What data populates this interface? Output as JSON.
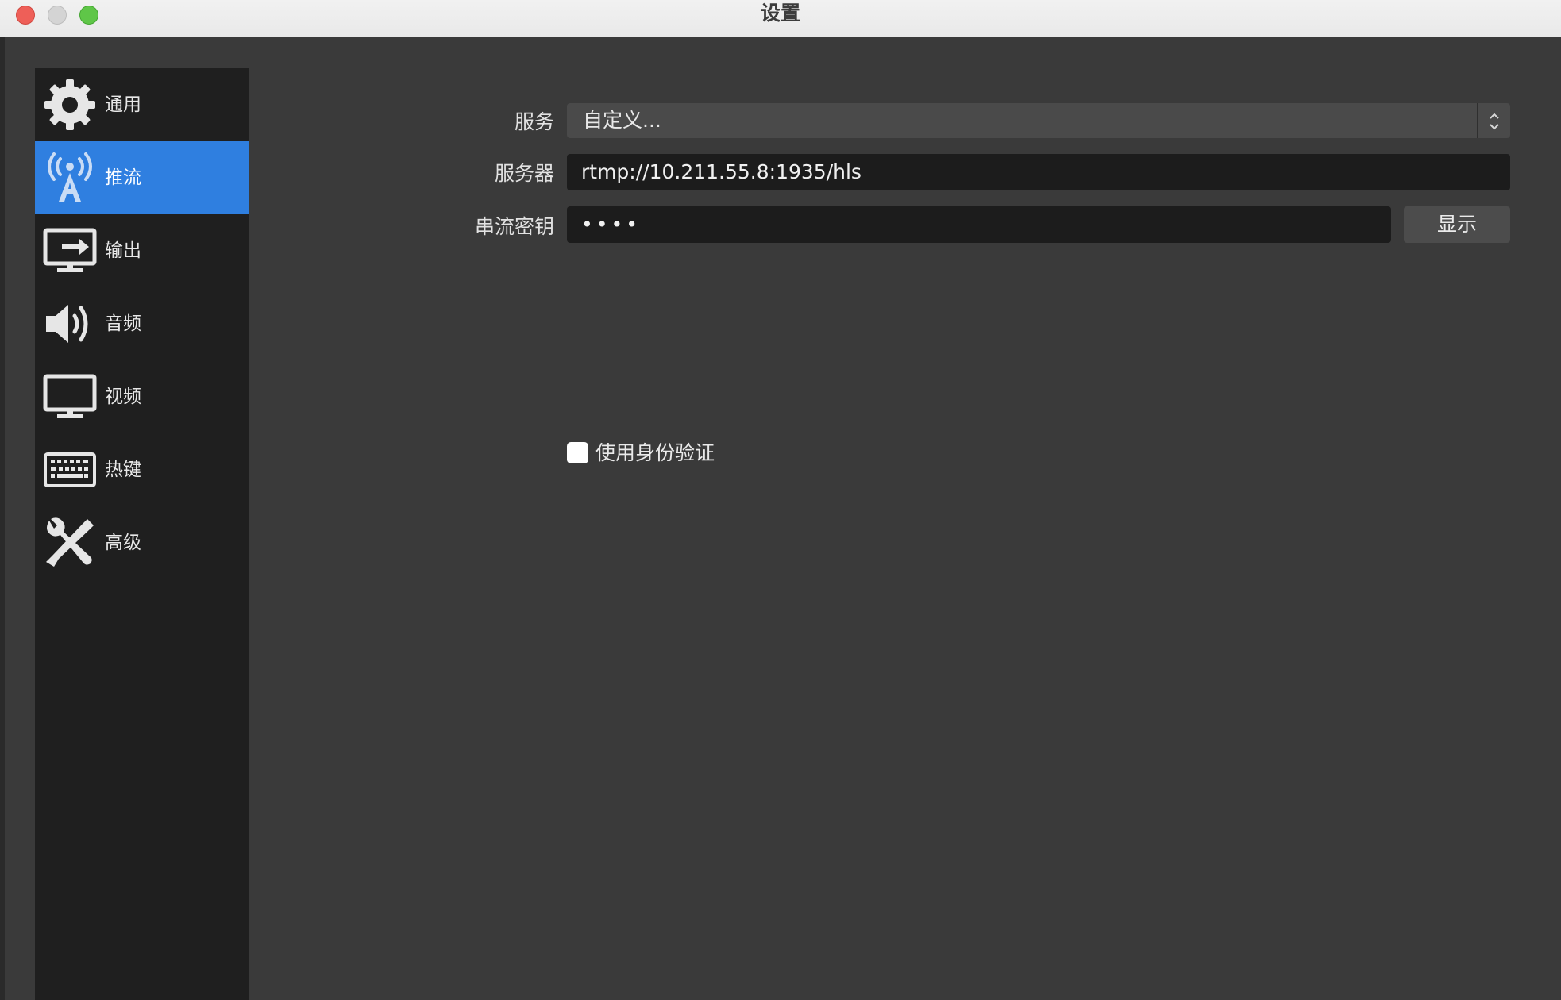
{
  "window": {
    "title": "设置"
  },
  "sidebar": {
    "items": [
      {
        "label": "通用",
        "icon": "gear-icon",
        "active": false
      },
      {
        "label": "推流",
        "icon": "broadcast-antenna-icon",
        "active": true
      },
      {
        "label": "输出",
        "icon": "output-monitor-icon",
        "active": false
      },
      {
        "label": "音频",
        "icon": "speaker-icon",
        "active": false
      },
      {
        "label": "视频",
        "icon": "monitor-icon",
        "active": false
      },
      {
        "label": "热键",
        "icon": "keyboard-icon",
        "active": false
      },
      {
        "label": "高级",
        "icon": "wrench-screwdriver-icon",
        "active": false
      }
    ]
  },
  "form": {
    "service_label": "服务",
    "service_value": "自定义...",
    "server_label": "服务器",
    "server_value": "rtmp://10.211.55.8:1935/hls",
    "key_label": "串流密钥",
    "key_value": "••••",
    "show_button": "显示",
    "auth_label": "使用身份验证",
    "auth_checked": false
  },
  "colors": {
    "accent": "#2f7fe0",
    "background": "#3a3a3a",
    "sidebar": "#1f1f1f",
    "field": "#1c1c1c",
    "close": "#ee5f58",
    "maximize": "#5fc648"
  }
}
